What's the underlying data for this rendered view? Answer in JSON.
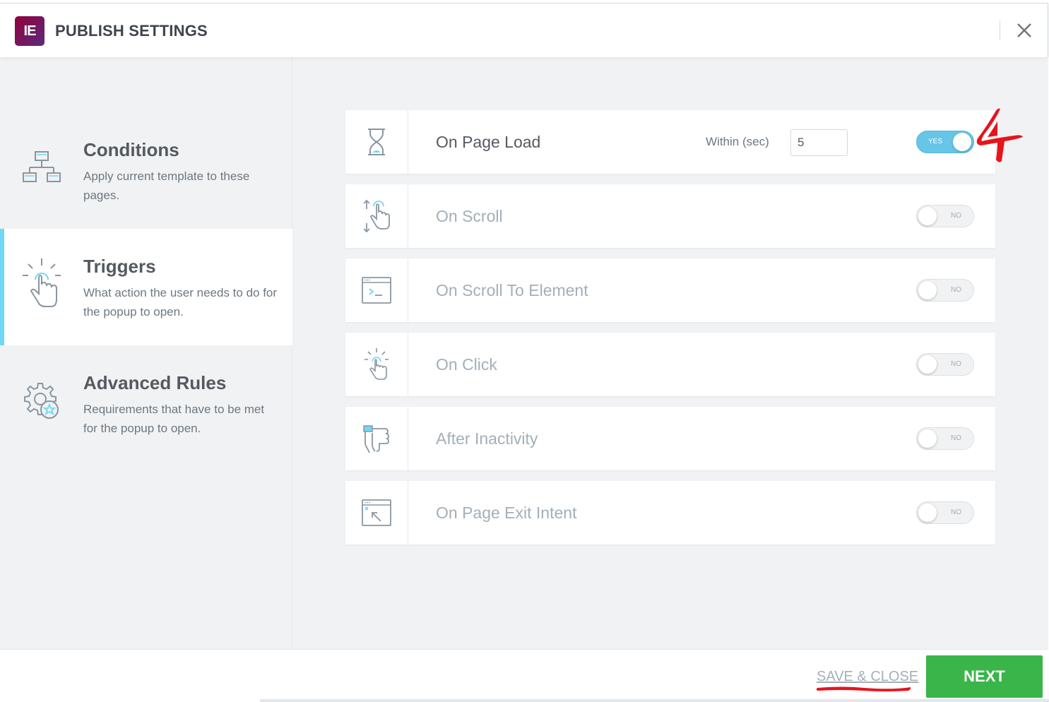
{
  "header": {
    "logo_text": "IE",
    "title": "PUBLISH SETTINGS"
  },
  "sidebar": {
    "items": [
      {
        "title": "Conditions",
        "description": "Apply current template to these pages.",
        "icon": "sitemap-icon",
        "active": false
      },
      {
        "title": "Triggers",
        "description": "What action the user needs to do for the popup to open.",
        "icon": "tap-hand-icon",
        "active": true
      },
      {
        "title": "Advanced Rules",
        "description": "Requirements that have to be met for the popup to open.",
        "icon": "gear-star-icon",
        "active": false
      }
    ]
  },
  "triggers": [
    {
      "label": "On Page Load",
      "icon": "hourglass-icon",
      "enabled": true,
      "toggle_text": "YES",
      "within_label": "Within (sec)",
      "within_value": "5"
    },
    {
      "label": "On Scroll",
      "icon": "scroll-hand-icon",
      "enabled": false,
      "toggle_text": "NO"
    },
    {
      "label": "On Scroll To Element",
      "icon": "terminal-window-icon",
      "enabled": false,
      "toggle_text": "NO"
    },
    {
      "label": "On Click",
      "icon": "click-hand-icon",
      "enabled": false,
      "toggle_text": "NO"
    },
    {
      "label": "After Inactivity",
      "icon": "idle-hand-icon",
      "enabled": false,
      "toggle_text": "NO"
    },
    {
      "label": "On Page Exit Intent",
      "icon": "exit-window-icon",
      "enabled": false,
      "toggle_text": "NO"
    }
  ],
  "footer": {
    "save_close_label": "SAVE & CLOSE",
    "next_label": "NEXT"
  },
  "colors": {
    "accent": "#71d7f7",
    "toggle_on": "#67c5e8",
    "next_button": "#39b54a",
    "annotation": "#e8131b"
  }
}
